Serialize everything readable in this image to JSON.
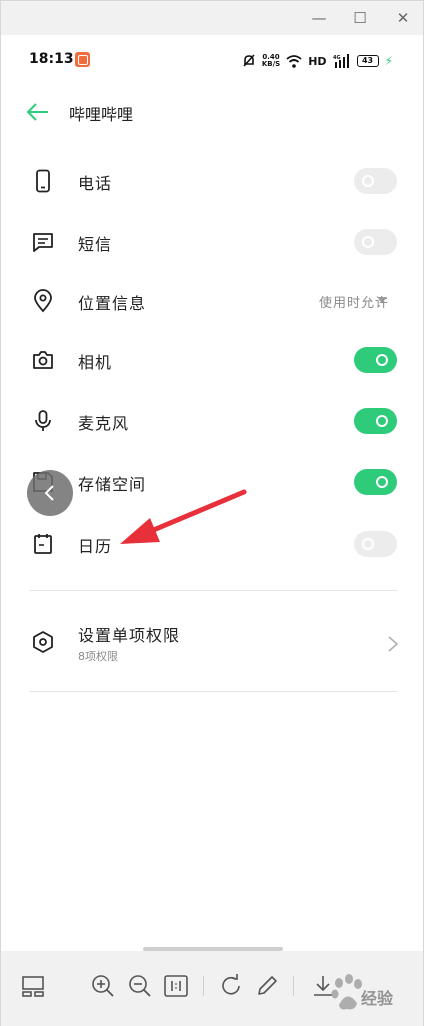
{
  "window": {
    "minimize": "—",
    "maximize": "☐",
    "close": "✕"
  },
  "status_bar": {
    "time": "18:13",
    "net_speed_value": "0.40",
    "net_speed_unit": "KB/S",
    "hd": "HD",
    "battery": "43"
  },
  "header": {
    "title": "哔哩哔哩"
  },
  "permissions": [
    {
      "label": "电话",
      "icon": "phone-icon",
      "state": "off"
    },
    {
      "label": "短信",
      "icon": "message-icon",
      "state": "off"
    },
    {
      "label": "位置信息",
      "icon": "location-icon",
      "state": "select",
      "value": "使用时允许"
    },
    {
      "label": "相机",
      "icon": "camera-icon",
      "state": "on"
    },
    {
      "label": "麦克风",
      "icon": "microphone-icon",
      "state": "on"
    },
    {
      "label": "存储空间",
      "icon": "storage-icon",
      "state": "on"
    },
    {
      "label": "日历",
      "icon": "calendar-icon",
      "state": "off"
    }
  ],
  "settings": {
    "label": "设置单项权限",
    "sub": "8项权限"
  },
  "colors": {
    "accent": "#2ecb7a",
    "toggle_off": "#ececec",
    "arrow": "#e8303a"
  },
  "watermark": {
    "text": "经验"
  }
}
